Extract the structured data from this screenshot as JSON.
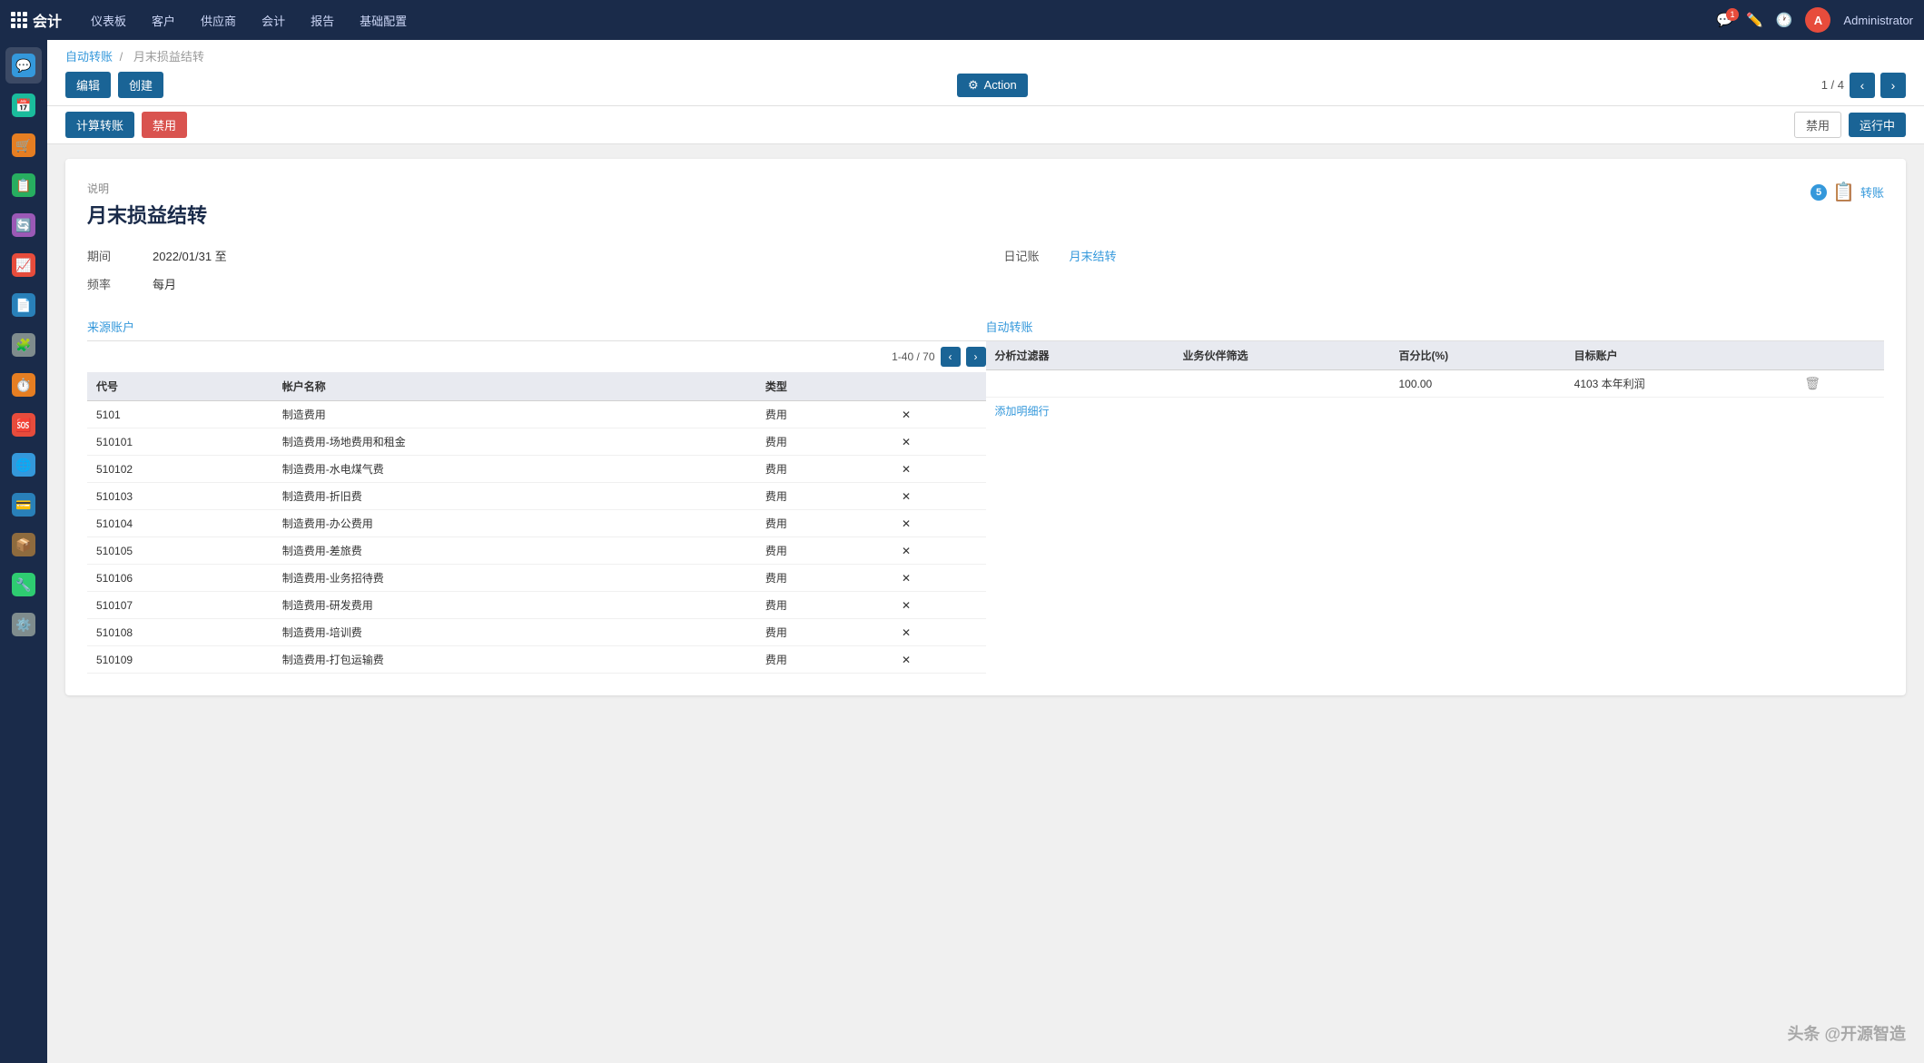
{
  "app": {
    "title": "会计",
    "nav_items": [
      "仪表板",
      "客户",
      "供应商",
      "会计",
      "报告",
      "基础配置"
    ]
  },
  "user": {
    "name": "Administrator",
    "avatar_letter": "A"
  },
  "sidebar": {
    "items": [
      {
        "icon": "💬",
        "color": "si-blue",
        "label": "消息"
      },
      {
        "icon": "📅",
        "color": "si-teal",
        "label": "日历"
      },
      {
        "icon": "🛒",
        "color": "si-orange",
        "label": "购物"
      },
      {
        "icon": "📋",
        "color": "si-green",
        "label": "任务"
      },
      {
        "icon": "🔄",
        "color": "si-purple",
        "label": "同步"
      },
      {
        "icon": "📈",
        "color": "si-red",
        "label": "报表"
      },
      {
        "icon": "📄",
        "color": "si-darkblue",
        "label": "文档"
      },
      {
        "icon": "🧩",
        "color": "si-gray",
        "label": "模块"
      },
      {
        "icon": "⏱️",
        "color": "si-orange",
        "label": "时间"
      },
      {
        "icon": "🆘",
        "color": "si-red",
        "label": "帮助"
      },
      {
        "icon": "🌐",
        "color": "si-blue",
        "label": "网络"
      },
      {
        "icon": "💳",
        "color": "si-darkblue",
        "label": "支付"
      },
      {
        "icon": "📦",
        "color": "si-brown",
        "label": "库存"
      },
      {
        "icon": "🔧",
        "color": "si-lime",
        "label": "工具"
      },
      {
        "icon": "⚙️",
        "color": "si-gray",
        "label": "设置"
      }
    ]
  },
  "breadcrumb": {
    "parent": "自动转账",
    "separator": "/",
    "current": "月末损益结转"
  },
  "toolbar": {
    "edit_label": "编辑",
    "create_label": "创建",
    "action_label": "Action",
    "compute_label": "计算转账",
    "disable_label": "禁用",
    "pagination": "1 / 4",
    "status_inactive": "禁用",
    "status_active": "运行中"
  },
  "card": {
    "badge_count": "5",
    "badge_label": "转账",
    "section_label": "说明",
    "title": "月末损益结转",
    "period_label": "期间",
    "period_value": "2022/01/31 至",
    "frequency_label": "频率",
    "frequency_value": "每月",
    "journal_label": "日记账",
    "journal_value": "月末结转"
  },
  "source_table": {
    "header_label": "来源账户",
    "pagination": "1-40 / 70",
    "columns": [
      "代号",
      "帐户名称",
      "类型",
      ""
    ],
    "rows": [
      {
        "code": "5101",
        "name": "制造费用",
        "type": "费用"
      },
      {
        "code": "510101",
        "name": "制造费用-场地费用和租金",
        "type": "费用"
      },
      {
        "code": "510102",
        "name": "制造费用-水电煤气费",
        "type": "费用"
      },
      {
        "code": "510103",
        "name": "制造费用-折旧费",
        "type": "费用"
      },
      {
        "code": "510104",
        "name": "制造费用-办公费用",
        "type": "费用"
      },
      {
        "code": "510105",
        "name": "制造费用-差旅费",
        "type": "费用"
      },
      {
        "code": "510106",
        "name": "制造费用-业务招待费",
        "type": "费用"
      },
      {
        "code": "510107",
        "name": "制造费用-研发费用",
        "type": "费用"
      },
      {
        "code": "510108",
        "name": "制造费用-培训费",
        "type": "费用"
      },
      {
        "code": "510109",
        "name": "制造费用-打包运输费",
        "type": "费用"
      }
    ]
  },
  "auto_table": {
    "header_label": "自动转账",
    "columns": [
      "分析过滤器",
      "业务伙伴筛选",
      "百分比(%)",
      "目标账户",
      ""
    ],
    "rows": [
      {
        "filter": "",
        "partner": "",
        "percent": "100.00",
        "account": "4103 本年利润"
      }
    ],
    "add_label": "添加明细行"
  },
  "watermark": "头条 @开源智造"
}
